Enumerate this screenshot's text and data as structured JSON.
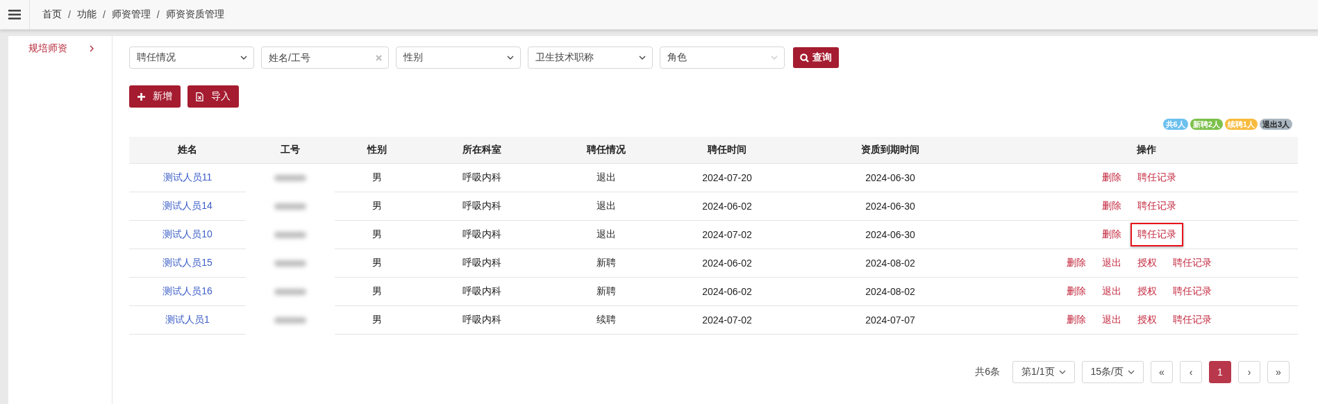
{
  "breadcrumb": [
    "首页",
    "功能",
    "师资管理",
    "师资资质管理"
  ],
  "breadcrumb_separator": "/",
  "sidebar": {
    "items": [
      {
        "label": "规培师资",
        "selected": true
      }
    ]
  },
  "filters": [
    {
      "kind": "select",
      "placeholder": "聘任情况"
    },
    {
      "kind": "text",
      "placeholder": "姓名/工号"
    },
    {
      "kind": "select",
      "placeholder": "性别"
    },
    {
      "kind": "select",
      "placeholder": "卫生技术职称"
    },
    {
      "kind": "select",
      "placeholder": "角色"
    }
  ],
  "search_button": "查询",
  "actions": [
    {
      "kind": "add",
      "label": "新增"
    },
    {
      "kind": "import",
      "label": "导入"
    }
  ],
  "badges": [
    {
      "label": "共6人",
      "color": "#6cc0ee"
    },
    {
      "label": "新聘2人",
      "color": "#7cc04b"
    },
    {
      "label": "续聘1人",
      "color": "#f8bb3e"
    },
    {
      "label": "退出3人",
      "color": "#a9b5bf"
    }
  ],
  "table": {
    "columns": [
      "姓名",
      "工号",
      "性别",
      "所在科室",
      "聘任情况",
      "聘任时间",
      "资质到期时间",
      "操作"
    ],
    "rows": [
      {
        "name": "测试人员11",
        "gender": "男",
        "department": "呼吸内科",
        "status": "退出",
        "hire_date": "2024-07-20",
        "expiry_date": "2024-06-30",
        "operations": [
          {
            "label": "删除",
            "highlighted": false
          },
          {
            "label": "聘任记录",
            "highlighted": false
          }
        ]
      },
      {
        "name": "测试人员14",
        "gender": "男",
        "department": "呼吸内科",
        "status": "退出",
        "hire_date": "2024-06-02",
        "expiry_date": "2024-06-30",
        "operations": [
          {
            "label": "删除",
            "highlighted": false
          },
          {
            "label": "聘任记录",
            "highlighted": false
          }
        ]
      },
      {
        "name": "测试人员10",
        "gender": "男",
        "department": "呼吸内科",
        "status": "退出",
        "hire_date": "2024-07-02",
        "expiry_date": "2024-06-30",
        "operations": [
          {
            "label": "删除",
            "highlighted": false
          },
          {
            "label": "聘任记录",
            "highlighted": true
          }
        ]
      },
      {
        "name": "测试人员15",
        "gender": "男",
        "department": "呼吸内科",
        "status": "新聘",
        "hire_date": "2024-06-02",
        "expiry_date": "2024-08-02",
        "operations": [
          {
            "label": "删除",
            "highlighted": false
          },
          {
            "label": "退出",
            "highlighted": false
          },
          {
            "label": "授权",
            "highlighted": false
          },
          {
            "label": "聘任记录",
            "highlighted": false
          }
        ]
      },
      {
        "name": "测试人员16",
        "gender": "男",
        "department": "呼吸内科",
        "status": "新聘",
        "hire_date": "2024-06-02",
        "expiry_date": "2024-08-02",
        "operations": [
          {
            "label": "删除",
            "highlighted": false
          },
          {
            "label": "退出",
            "highlighted": false
          },
          {
            "label": "授权",
            "highlighted": false
          },
          {
            "label": "聘任记录",
            "highlighted": false
          }
        ]
      },
      {
        "name": "测试人员1",
        "gender": "男",
        "department": "呼吸内科",
        "status": "续聘",
        "hire_date": "2024-07-02",
        "expiry_date": "2024-07-07",
        "operations": [
          {
            "label": "删除",
            "highlighted": false
          },
          {
            "label": "退出",
            "highlighted": false
          },
          {
            "label": "授权",
            "highlighted": false
          },
          {
            "label": "聘任记录",
            "highlighted": false
          }
        ]
      }
    ]
  },
  "pager": {
    "total": "共6条",
    "page_select": "第1/1页",
    "size_select": "15条/页",
    "buttons": [
      {
        "label": "«",
        "selected": false
      },
      {
        "label": "‹",
        "selected": false
      },
      {
        "label": "1",
        "selected": true
      },
      {
        "label": "›",
        "selected": false
      },
      {
        "label": "»",
        "selected": false
      }
    ]
  }
}
